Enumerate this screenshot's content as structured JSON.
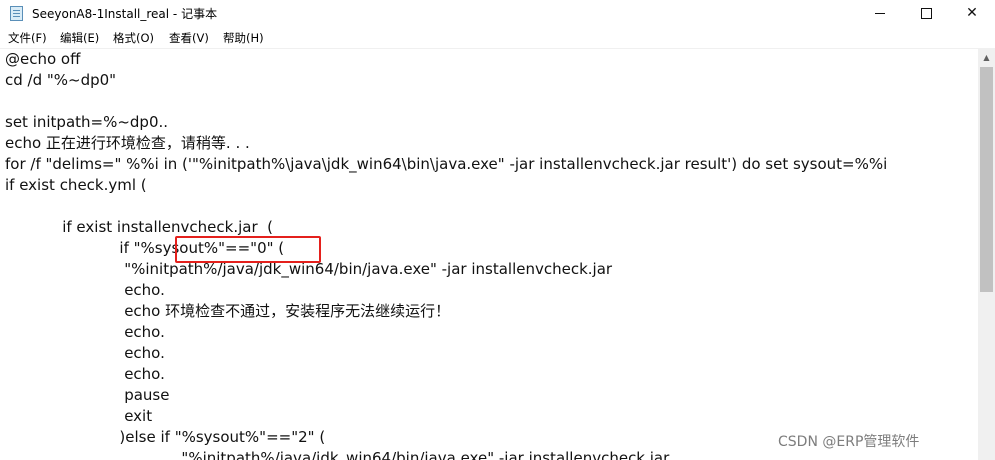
{
  "window": {
    "title": "SeeyonA8-1Install_real - 记事本",
    "icon": "notepad-icon",
    "controls": {
      "minimize": "minimize-icon",
      "maximize": "maximize-icon",
      "close": "close-icon",
      "close_glyph": "✕"
    }
  },
  "menu": {
    "file": "文件(F)",
    "edit": "编辑(E)",
    "format": "格式(O)",
    "view": "查看(V)",
    "help": "帮助(H)"
  },
  "editor": {
    "lines": [
      "@echo off",
      "cd /d \"%~dp0\"",
      "",
      "set initpath=%~dp0..",
      "echo 正在进行环境检查，请稍等. . .",
      "for /f \"delims=\" %%i in ('\"%initpath%\\java\\jdk_win64\\bin\\java.exe\" -jar installenvcheck.jar result') do set sysout=%%i",
      "if exist check.yml (",
      "",
      "            if exist installenvcheck.jar  (",
      "                        if \"%sysout%\"==\"0\" (",
      "                         \"%initpath%/java/jdk_win64/bin/java.exe\" -jar installenvcheck.jar",
      "                         echo.",
      "                         echo 环境检查不通过，安装程序无法继续运行！",
      "                         echo.",
      "                         echo.",
      "                         echo.",
      "                         pause",
      "                         exit",
      "                        )else if \"%sysout%\"==\"2\" (",
      "                                     \"%initpath%/java/jdk_win64/bin/java.exe\" -jar installenvcheck.jar"
    ]
  },
  "annotation": {
    "color": "#e4201c",
    "target": "\"%sysout%\"==\"0\""
  },
  "watermark": "CSDN @ERP管理软件"
}
